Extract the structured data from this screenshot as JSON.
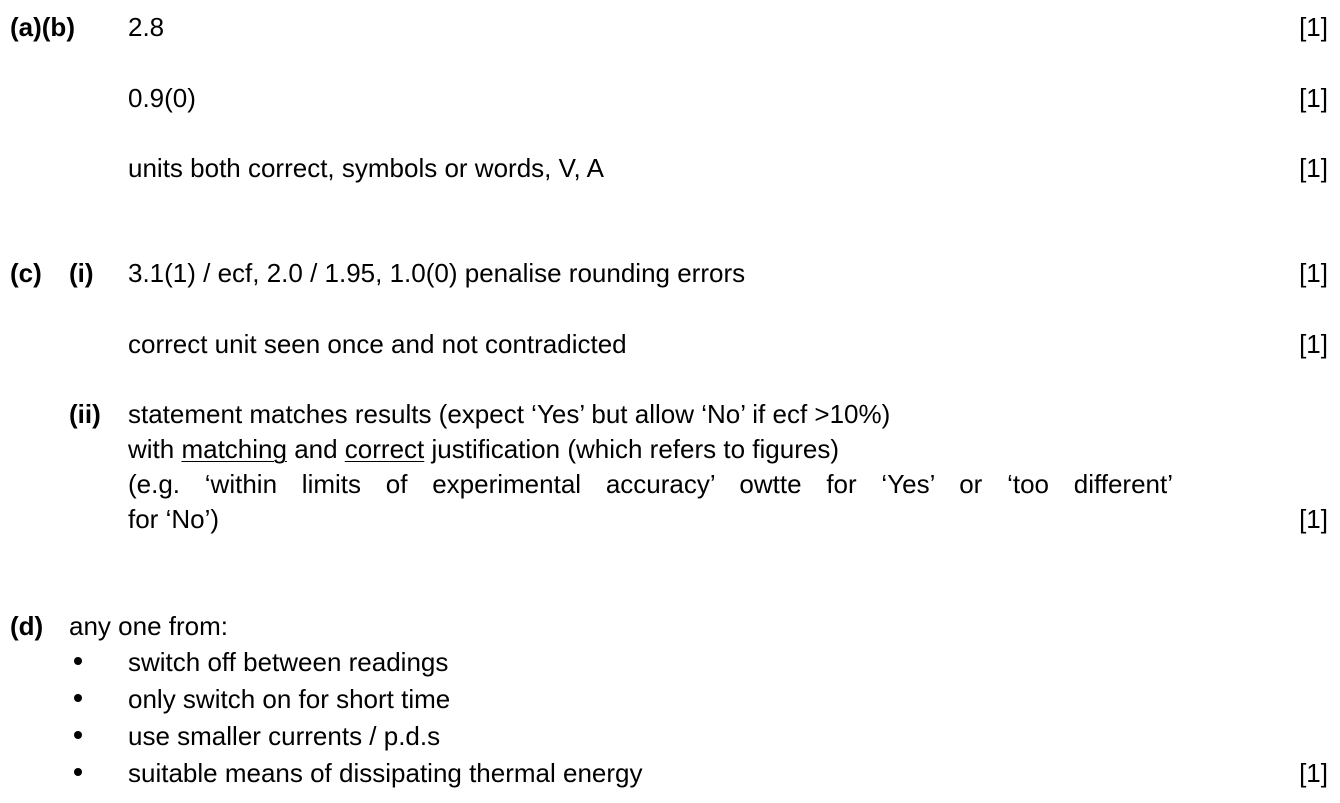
{
  "part_ab": {
    "label": "(a)(b)",
    "lines": [
      {
        "text": "2.8",
        "mark": "[1]"
      },
      {
        "text": "0.9(0)",
        "mark": "[1]"
      },
      {
        "text": "units both correct, symbols or words, V, A",
        "mark": "[1]"
      }
    ]
  },
  "part_c": {
    "label": "(c)",
    "sub_i": {
      "label": "(i)",
      "lines": [
        {
          "text": "3.1(1) / ecf, 2.0 / 1.95, 1.0(0) penalise rounding errors",
          "mark": "[1]"
        },
        {
          "text": "correct unit seen once and not contradicted",
          "mark": "[1]"
        }
      ]
    },
    "sub_ii": {
      "label": "(ii)",
      "line1": "statement matches results (expect ‘Yes’ but allow ‘No’ if ecf >10%)",
      "line2_pre": "with ",
      "line2_u1": "matching",
      "line2_mid": " and ",
      "line2_u2": "correct",
      "line2_post": " justification (which refers to figures)",
      "line3": "(e.g. ‘within limits of experimental accuracy’ owtte for ‘Yes’ or ‘too different’",
      "line4": "for ‘No’)",
      "mark": "[1]"
    }
  },
  "part_d": {
    "label": "(d)",
    "intro": "any one from:",
    "bullets": [
      "switch off between readings",
      "only switch on for short time",
      "use smaller currents / p.d.s",
      "suitable means of dissipating thermal energy"
    ],
    "mark": "[1]"
  }
}
